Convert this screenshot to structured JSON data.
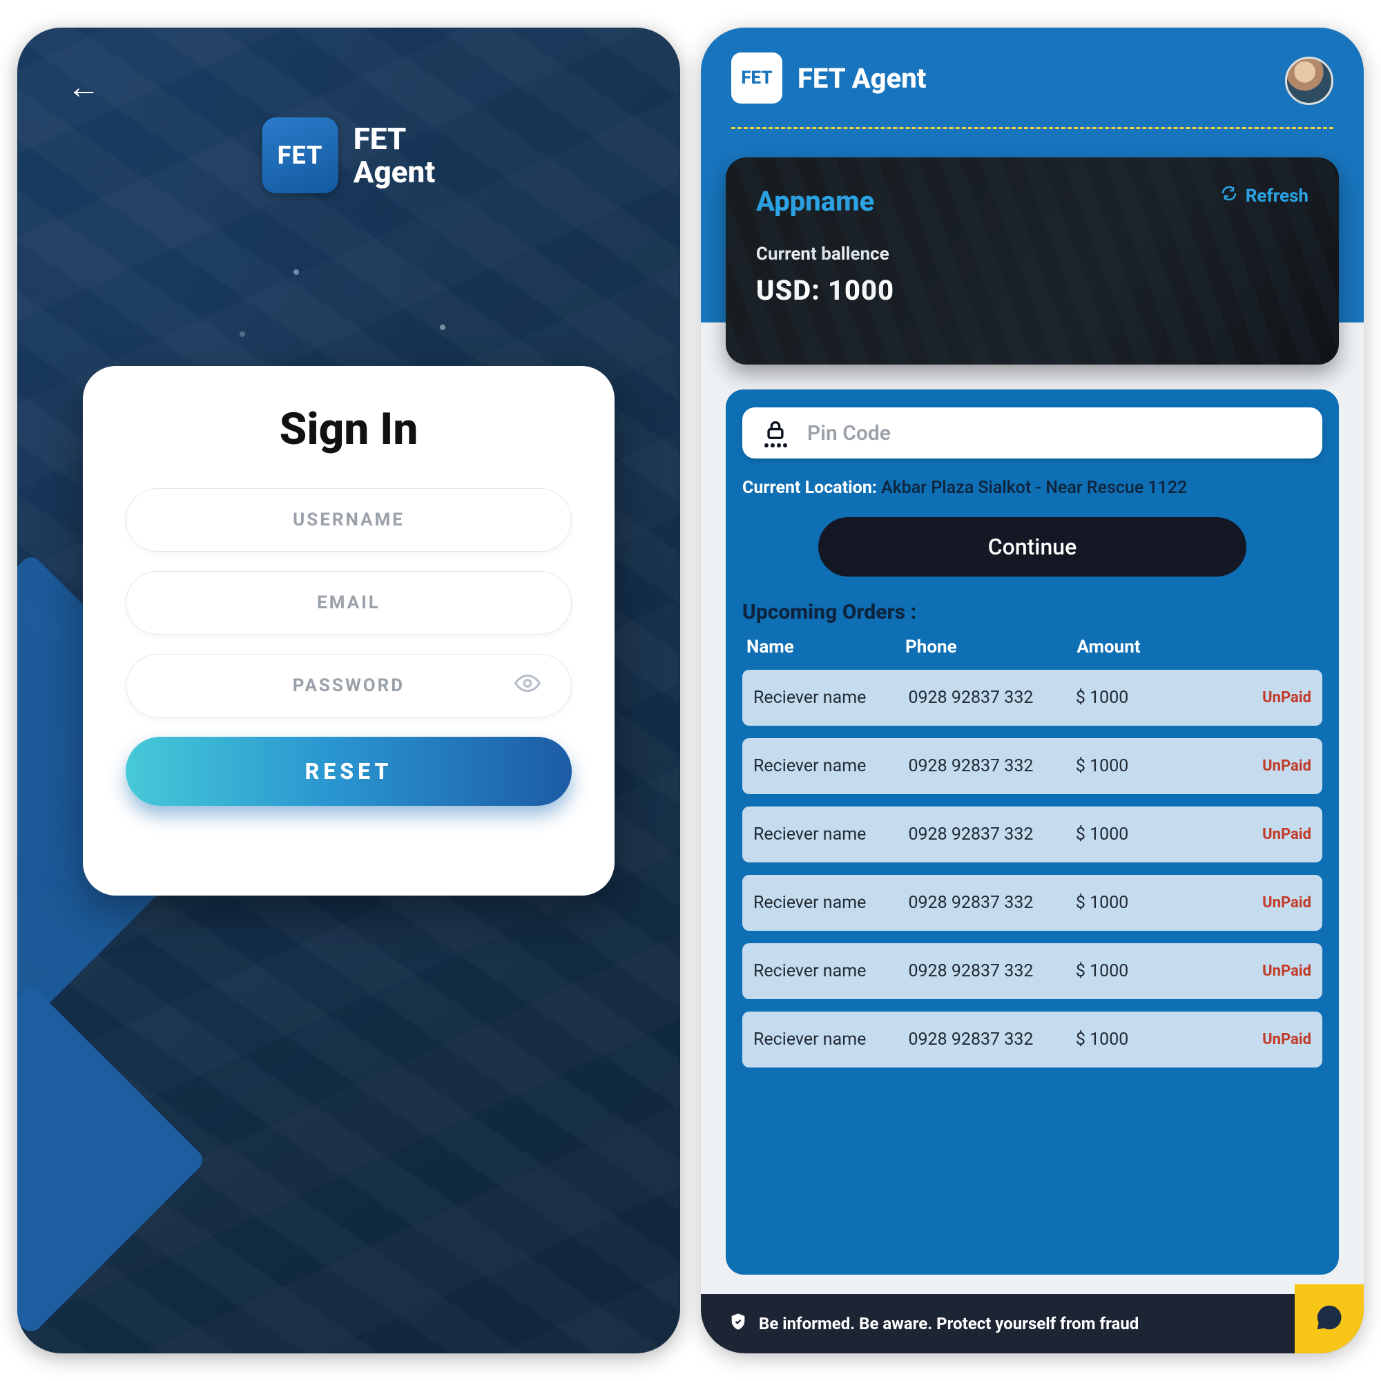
{
  "left": {
    "logo_text": "FET",
    "brand_line1": "FET",
    "brand_line2": "Agent",
    "title": "Sign In",
    "username_ph": "USERNAME",
    "email_ph": "EMAIL",
    "password_ph": "PASSWORD",
    "reset_label": "RESET"
  },
  "right": {
    "logo_text": "FET",
    "app_title": "FET Agent",
    "balance": {
      "title": "Appname",
      "refresh": "Refresh",
      "sub": "Current ballence",
      "amount": "USD:  1000"
    },
    "pin_placeholder": "Pin Code",
    "location_label": "Current Location:",
    "location_value": "Akbar Plaza Sialkot - Near Rescue 1122",
    "continue_label": "Continue",
    "orders_title": "Upcoming Orders :",
    "columns": {
      "name": "Name",
      "phone": "Phone",
      "amount": "Amount"
    },
    "orders": [
      {
        "name": "Reciever name",
        "phone": "0928 92837 332",
        "amount": "$ 1000",
        "status": "UnPaid"
      },
      {
        "name": "Reciever name",
        "phone": "0928 92837 332",
        "amount": "$ 1000",
        "status": "UnPaid"
      },
      {
        "name": "Reciever name",
        "phone": "0928 92837 332",
        "amount": "$ 1000",
        "status": "UnPaid"
      },
      {
        "name": "Reciever name",
        "phone": "0928 92837 332",
        "amount": "$ 1000",
        "status": "UnPaid"
      },
      {
        "name": "Reciever name",
        "phone": "0928 92837 332",
        "amount": "$ 1000",
        "status": "UnPaid"
      },
      {
        "name": "Reciever name",
        "phone": "0928 92837 332",
        "amount": "$ 1000",
        "status": "UnPaid"
      }
    ],
    "fraud_text": "Be informed. Be aware. Protect yourself from fraud"
  }
}
